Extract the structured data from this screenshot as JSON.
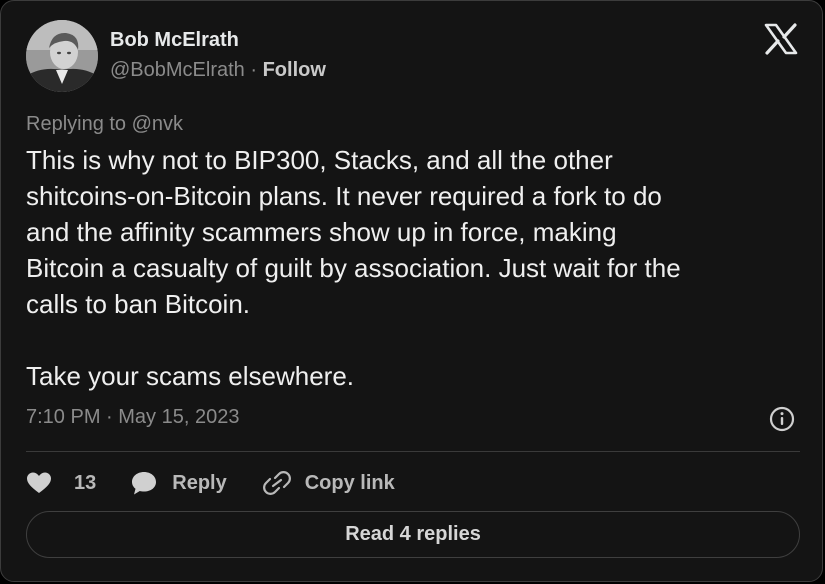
{
  "author": {
    "name": "Bob McElrath",
    "handle": "@BobMcElrath",
    "separator": " · ",
    "follow_label": "Follow"
  },
  "reply_context": "Replying to @nvk",
  "body": "This is why not to BIP300, Stacks, and all the other\nshitcoins-on-Bitcoin plans. It never required a fork to do\nand the affinity scammers show up in force, making\nBitcoin a casualty of guilt by association. Just wait for the\ncalls to ban Bitcoin.\n\nTake your scams elsewhere.",
  "timestamp": "7:10 PM · May 15, 2023",
  "actions": {
    "like_count": "13",
    "reply_label": "Reply",
    "copy_label": "Copy link"
  },
  "read_replies_label": "Read 4 replies",
  "icons": {
    "brand": "x-logo-icon",
    "info": "info-icon",
    "like": "heart-icon",
    "reply": "speech-bubble-icon",
    "copy": "link-icon"
  },
  "colors": {
    "background": "#141414",
    "text": "#e7e9ea",
    "muted": "#8b8b8b",
    "border": "#3c3c3c"
  }
}
